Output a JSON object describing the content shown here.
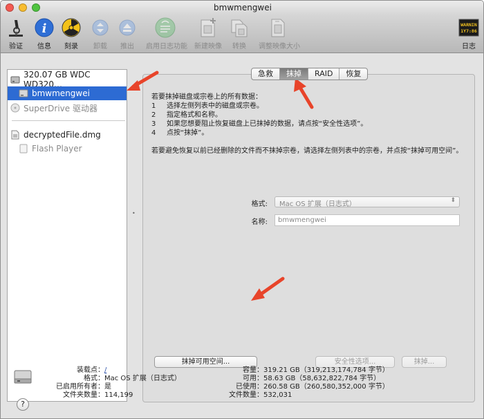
{
  "window": {
    "title": "bmwmengwei"
  },
  "toolbar": {
    "items": [
      {
        "label": "验证",
        "icon": "microscope-icon"
      },
      {
        "label": "信息",
        "icon": "info-icon"
      },
      {
        "label": "刻录",
        "icon": "burn-icon"
      },
      {
        "label": "卸载",
        "icon": "unmount-icon"
      },
      {
        "label": "推出",
        "icon": "eject-icon"
      },
      {
        "label": "启用日志功能",
        "icon": "enable-journaling-icon"
      },
      {
        "label": "新建映像",
        "icon": "new-image-icon"
      },
      {
        "label": "转换",
        "icon": "convert-icon"
      },
      {
        "label": "调整映像大小",
        "icon": "resize-image-icon"
      },
      {
        "label": "日志",
        "icon": "log-icon"
      }
    ],
    "log_icon_text": "WARNIN\n1Y7:86"
  },
  "sidebar": {
    "items": [
      {
        "label": "320.07 GB WDC WD320…",
        "icon": "hard-drive-icon"
      },
      {
        "label": "bmwmengwei",
        "icon": "volume-icon"
      },
      {
        "label": "SuperDrive 驱动器",
        "icon": "optical-drive-icon"
      },
      {
        "label": "decryptedFile.dmg",
        "icon": "dmg-file-icon"
      },
      {
        "label": "Flash Player",
        "icon": "volume-icon"
      }
    ]
  },
  "tabs": [
    "急救",
    "抹掉",
    "RAID",
    "恢复"
  ],
  "active_tab": "抹掉",
  "erase": {
    "intro": "若要抹掉磁盘或宗卷上的所有数据：",
    "steps": [
      {
        "n": "1",
        "text": "选择左侧列表中的磁盘或宗卷。"
      },
      {
        "n": "2",
        "text": "指定格式和名称。"
      },
      {
        "n": "3",
        "text": "如果您想要阻止恢复磁盘上已抹掉的数据，请点按“安全性选项”。"
      },
      {
        "n": "4",
        "text": "点按“抹掉”。"
      }
    ],
    "note": "若要避免恢复以前已经删除的文件而不抹掉宗卷，请选择左侧列表中的宗卷，并点按“抹掉可用空间”。",
    "format_label": "格式:",
    "format_value": "Mac OS 扩展（日志式）",
    "name_label": "名称:",
    "name_value": "bmwmengwei",
    "erase_free_space_button": "抹掉可用空间...",
    "security_options_button": "安全性选项...",
    "erase_button": "抹掉..."
  },
  "bottom_info": {
    "left": [
      {
        "k": "装载点：",
        "v": "/"
      },
      {
        "k": "格式：",
        "v": "Mac OS 扩展（日志式）"
      },
      {
        "k": "已启用所有者：",
        "v": "是"
      },
      {
        "k": "文件夹数量：",
        "v": "114,199"
      }
    ],
    "right": [
      {
        "k": "容量：",
        "v": "319.21 GB（319,213,174,784 字节）"
      },
      {
        "k": "可用：",
        "v": "58.63 GB（58,632,822,784 字节）"
      },
      {
        "k": "已使用：",
        "v": "260.58 GB（260,580,352,000 字节）"
      },
      {
        "k": "文件数量：",
        "v": "532,031"
      }
    ],
    "help": "?"
  },
  "colors": {
    "selection": "#2d6bd3",
    "annotation_arrow": "#e8442a"
  }
}
